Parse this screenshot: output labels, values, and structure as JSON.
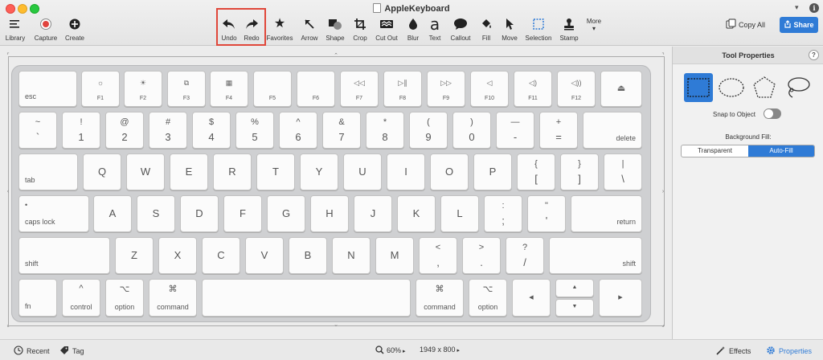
{
  "window": {
    "title": "AppleKeyboard"
  },
  "toolbar": {
    "library": "Library",
    "capture": "Capture",
    "create": "Create",
    "undo": "Undo",
    "redo": "Redo",
    "favorites": "Favorites",
    "arrow": "Arrow",
    "shape": "Shape",
    "crop": "Crop",
    "cutout": "Cut Out",
    "blur": "Blur",
    "text": "Text",
    "text_glyph": "a",
    "callout": "Callout",
    "fill": "Fill",
    "move": "Move",
    "selection": "Selection",
    "stamp": "Stamp",
    "more": "More",
    "copy_all": "Copy All",
    "share": "Share"
  },
  "highlight_color": "#e0473a",
  "accent_color": "#2f7bd6",
  "keyboard": {
    "fn_row": [
      {
        "label": "esc"
      },
      {
        "icon": "☼",
        "label": "F1"
      },
      {
        "icon": "☀",
        "label": "F2"
      },
      {
        "icon": "⧉",
        "label": "F3"
      },
      {
        "icon": "▦",
        "label": "F4"
      },
      {
        "icon": "",
        "label": "F5"
      },
      {
        "icon": "",
        "label": "F6"
      },
      {
        "icon": "◁◁",
        "label": "F7"
      },
      {
        "icon": "▷∥",
        "label": "F8"
      },
      {
        "icon": "▷▷",
        "label": "F9"
      },
      {
        "icon": "◁",
        "label": "F10"
      },
      {
        "icon": "◁)",
        "label": "F11"
      },
      {
        "icon": "◁))",
        "label": "F12"
      },
      {
        "icon": "⏏"
      }
    ],
    "num_row": [
      {
        "top": "~",
        "bottom": "`"
      },
      {
        "top": "!",
        "bottom": "1"
      },
      {
        "top": "@",
        "bottom": "2"
      },
      {
        "top": "#",
        "bottom": "3"
      },
      {
        "top": "$",
        "bottom": "4"
      },
      {
        "top": "%",
        "bottom": "5"
      },
      {
        "top": "^",
        "bottom": "6"
      },
      {
        "top": "&",
        "bottom": "7"
      },
      {
        "top": "*",
        "bottom": "8"
      },
      {
        "top": "(",
        "bottom": "9"
      },
      {
        "top": ")",
        "bottom": "0"
      },
      {
        "top": "—",
        "bottom": "-"
      },
      {
        "top": "+",
        "bottom": "="
      },
      {
        "label": "delete"
      }
    ],
    "q_row": [
      {
        "label": "tab"
      },
      {
        "c": "Q"
      },
      {
        "c": "W"
      },
      {
        "c": "E"
      },
      {
        "c": "R"
      },
      {
        "c": "T"
      },
      {
        "c": "Y"
      },
      {
        "c": "U"
      },
      {
        "c": "I"
      },
      {
        "c": "O"
      },
      {
        "c": "P"
      },
      {
        "top": "{",
        "bottom": "["
      },
      {
        "top": "}",
        "bottom": "]"
      },
      {
        "top": "|",
        "bottom": "\\"
      }
    ],
    "a_row": [
      {
        "top": "•",
        "label": "caps lock"
      },
      {
        "c": "A"
      },
      {
        "c": "S"
      },
      {
        "c": "D"
      },
      {
        "c": "F"
      },
      {
        "c": "G"
      },
      {
        "c": "H"
      },
      {
        "c": "J"
      },
      {
        "c": "K"
      },
      {
        "c": "L"
      },
      {
        "top": ":",
        "bottom": ";"
      },
      {
        "top": "\"",
        "bottom": "'"
      },
      {
        "label": "return"
      }
    ],
    "z_row": [
      {
        "label": "shift"
      },
      {
        "c": "Z"
      },
      {
        "c": "X"
      },
      {
        "c": "C"
      },
      {
        "c": "V"
      },
      {
        "c": "B"
      },
      {
        "c": "N"
      },
      {
        "c": "M"
      },
      {
        "top": "<",
        "bottom": ","
      },
      {
        "top": ">",
        "bottom": "."
      },
      {
        "top": "?",
        "bottom": "/"
      },
      {
        "label": "shift"
      }
    ],
    "bottom_row": [
      {
        "label": "fn"
      },
      {
        "top": "^",
        "label": "control"
      },
      {
        "top": "⌥",
        "label": "option"
      },
      {
        "top": "⌘",
        "label": "command"
      },
      {
        "label": ""
      },
      {
        "top": "⌘",
        "label": "command"
      },
      {
        "top": "⌥",
        "label": "option"
      },
      {
        "icon": "◀"
      },
      {
        "icon": "▲"
      },
      {
        "icon": "▼"
      },
      {
        "icon": "▶"
      }
    ]
  },
  "panel": {
    "title": "Tool Properties",
    "help": "?",
    "snap_label": "Snap to Object",
    "bg_fill_label": "Background Fill:",
    "bg_options": [
      "Transparent",
      "Auto-Fill"
    ],
    "bg_selected": "Auto-Fill"
  },
  "status": {
    "recent": "Recent",
    "tag": "Tag",
    "zoom": "60%",
    "dims": "1949 x 800",
    "effects": "Effects",
    "properties": "Properties"
  }
}
